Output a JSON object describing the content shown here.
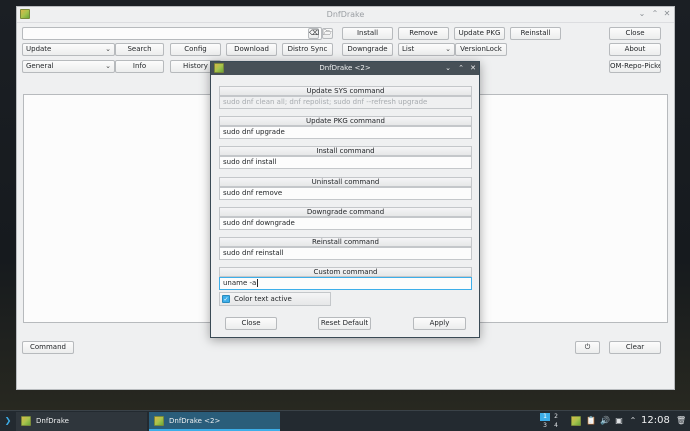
{
  "main": {
    "title": "DnfDrake",
    "search_value": "",
    "buttons": {
      "install": "Install",
      "remove": "Remove",
      "update_pkg": "Update PKG",
      "reinstall": "Reinstall",
      "close": "Close",
      "search": "Search",
      "config": "Config",
      "download": "Download",
      "distro_sync": "Distro Sync",
      "downgrade": "Downgrade",
      "versionlock": "VersionLock",
      "about": "About",
      "info": "Info",
      "history": "History",
      "om_repo_picker": "OM-Repo-Picker",
      "command": "Command",
      "clear": "Clear"
    },
    "combos": {
      "action": "Update",
      "list": "List",
      "category": "General"
    }
  },
  "dialog": {
    "title": "DnfDrake <2>",
    "groups": [
      {
        "label": "Update SYS command",
        "value": "sudo dnf clean all; dnf repolist; sudo dnf --refresh upgrade"
      },
      {
        "label": "Update PKG command",
        "value": "sudo dnf upgrade"
      },
      {
        "label": "Install command",
        "value": "sudo dnf install"
      },
      {
        "label": "Uninstall command",
        "value": "sudo dnf remove"
      },
      {
        "label": "Downgrade command",
        "value": "sudo dnf downgrade"
      },
      {
        "label": "Reinstall command",
        "value": "sudo dnf reinstall"
      },
      {
        "label": "Custom command",
        "value": "uname -a"
      }
    ],
    "checkbox_label": "Color text active",
    "checkbox_checked": true,
    "buttons": {
      "close": "Close",
      "reset": "Reset Default",
      "apply": "Apply"
    }
  },
  "taskbar": {
    "tasks": [
      "DnfDrake",
      "DnfDrake <2>"
    ],
    "pager": [
      "1",
      "2",
      "3",
      "4"
    ],
    "clock": "12:08"
  }
}
